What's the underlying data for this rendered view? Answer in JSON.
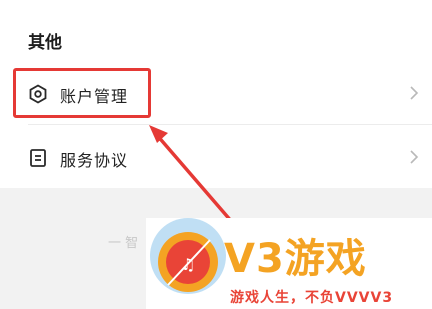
{
  "section": {
    "title": "其他"
  },
  "menu": [
    {
      "label": "账户管理",
      "icon": "hexagon-settings-icon"
    },
    {
      "label": "服务协议",
      "icon": "document-icon"
    }
  ],
  "faded": {
    "text": "一  智"
  },
  "watermark": {
    "title": "V3游戏",
    "subtitle": "游戏人生，不负VVVV3",
    "colors": {
      "orange": "#f4a323",
      "red": "#e94437",
      "blue": "#4aa3e0"
    }
  },
  "annotation": {
    "color": "#e53935"
  }
}
